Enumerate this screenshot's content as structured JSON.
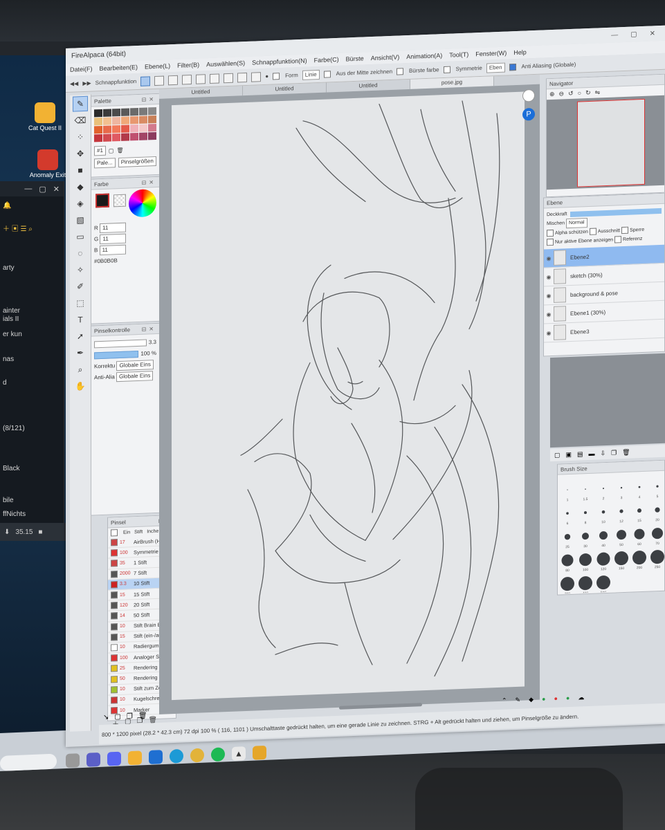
{
  "desktop": {
    "icons": [
      {
        "label": "Cat Quest II",
        "icon": "cat-quest-icon",
        "color": "#f2b233"
      },
      {
        "label": "Anomaly Exit",
        "icon": "train-icon",
        "color": "#d33a2c"
      }
    ]
  },
  "side_window": {
    "items": [
      "arty",
      "ainter",
      "ials II",
      "er kun",
      "nas",
      "d",
      "(8/121)",
      "Black",
      "bile",
      "ffNichts"
    ],
    "bottom_value": "35.15"
  },
  "app": {
    "title": "FireAlpaca (64bit)",
    "menu": [
      "Datei(F)",
      "Bearbeiten(E)",
      "Ebene(L)",
      "Filter(B)",
      "Auswählen(S)",
      "Schnappfunktion(N)",
      "Farbe(C)",
      "Bürste",
      "Ansicht(V)",
      "Animation(A)",
      "Tool(T)",
      "Fenster(W)",
      "Help"
    ],
    "toolbar": {
      "snap_label": "Schnappfunktion",
      "form_label": "Form",
      "form_value": "Linie",
      "fill_label": "Aus der Mitte zeichnen",
      "brush_color_label": "Bürste farbe",
      "symmetry_label": "Symmetrie",
      "symmetry_value": "Eben",
      "antialias_label": "Anti Aliasing (Globale)"
    },
    "tabs": [
      "Untitled",
      "Untitled",
      "Untitled",
      "pose.jpg"
    ],
    "palette": {
      "title": "Palette",
      "swatches": [
        "#2b2b2b",
        "#3b3b3b",
        "#4b4b4b",
        "#5a5a5a",
        "#6a6a6a",
        "#7a7a7a",
        "#8a8a8a",
        "#e9c07a",
        "#f2c090",
        "#eeb6a0",
        "#f0a878",
        "#e89870",
        "#d98b63",
        "#c88058",
        "#e2622e",
        "#e86a4a",
        "#f27a5a",
        "#e45a4a",
        "#f0b0b8",
        "#f4c7c7",
        "#d27a8c",
        "#c4363d",
        "#d24a4f",
        "#e05a62",
        "#b23a4a",
        "#c05070",
        "#a34466",
        "#8c3b5e"
      ],
      "preset": "#1",
      "tab1": "Pale...",
      "tab2": "Pinselgrößen"
    },
    "color": {
      "title": "Farbe",
      "r_label": "R",
      "r": "11",
      "g_label": "G",
      "g": "11",
      "b_label": "B",
      "b": "11",
      "hex": "#0B0B0B"
    },
    "brush_control": {
      "title": "Pinselkontrolle",
      "size": "3.3",
      "opacity": "100 %",
      "correction_label": "Korrektu",
      "correction_value": "Globale Eins",
      "antialias_label": "Anti-Alia",
      "antialias_value": "Globale Eins"
    },
    "brushes": {
      "title": "Pinsel",
      "filter_label": "Ein",
      "filter_col2": "Stift",
      "filter_col3": "Inche",
      "items": [
        {
          "size": "17",
          "name": "AirBrush (Hi",
          "color": "#c44"
        },
        {
          "size": "100",
          "name": "Symmetrie",
          "color": "#d33"
        },
        {
          "size": "35",
          "name": "1 Stift",
          "color": "#c44"
        },
        {
          "size": "2000",
          "name": "7 Stift",
          "color": "#555"
        },
        {
          "size": "3.3",
          "name": "10 Stift",
          "color": "#c22"
        },
        {
          "size": "15",
          "name": "15 Stift",
          "color": "#555"
        },
        {
          "size": "120",
          "name": "20 Stift",
          "color": "#555"
        },
        {
          "size": "14",
          "name": "50 Stift",
          "color": "#555"
        },
        {
          "size": "10",
          "name": "Stift Brain Ein",
          "color": "#555"
        },
        {
          "size": "15",
          "name": "Stift (ein-/aus)",
          "color": "#555"
        },
        {
          "size": "10",
          "name": "Radiergummi",
          "color": "#fff"
        },
        {
          "size": "100",
          "name": "Analoger Sti",
          "color": "#d33"
        },
        {
          "size": "25",
          "name": "Rendering (Ii",
          "color": "#e0c020"
        },
        {
          "size": "50",
          "name": "Rendering (I",
          "color": "#e0c020"
        },
        {
          "size": "10",
          "name": "Stift zum Ze",
          "color": "#a0c030"
        },
        {
          "size": "10",
          "name": "Kugelschreib",
          "color": "#c33"
        },
        {
          "size": "10",
          "name": "Marker",
          "color": "#d33"
        }
      ]
    },
    "navigator": {
      "title": "Navigator"
    },
    "layers": {
      "title": "Ebene",
      "opacity_label": "Deckkraft",
      "blend_label": "Mischen",
      "blend_value": "Normal",
      "alpha_label": "Alpha schützen",
      "clip_label": "Ausschnitt",
      "lock_label": "Sperre",
      "only_active_label": "Nur aktive Ebene anzeigen",
      "reference_label": "Referenz",
      "items": [
        {
          "name": "Ebene2",
          "selected": true
        },
        {
          "name": "sketch (30%)",
          "selected": false
        },
        {
          "name": "background & pose",
          "selected": false
        },
        {
          "name": "Ebene1 (30%)",
          "selected": false
        },
        {
          "name": "Ebene3",
          "selected": false
        }
      ]
    },
    "brush_size": {
      "title": "Brush Size",
      "labels": [
        "1",
        "1.5",
        "2",
        "3",
        "4",
        "5",
        "6",
        "8",
        "10",
        "12",
        "15",
        "20",
        "25",
        "30",
        "40",
        "50",
        "60",
        "70",
        "80",
        "100",
        "120",
        "150",
        "200",
        "250",
        "300",
        "400",
        "500"
      ]
    },
    "status": {
      "size": "800 * 1200 pixel",
      "physical": "(28.2 * 42.3 cm)",
      "dpi": "72 dpi",
      "zoom": "100 %",
      "coords": "( 116, 1101 )",
      "hint": "Umschalttaste gedrückt halten, um eine gerade Linie zu zeichnen. STRG + Alt gedrückt halten und ziehen, um Pinselgröße zu ändern."
    }
  }
}
